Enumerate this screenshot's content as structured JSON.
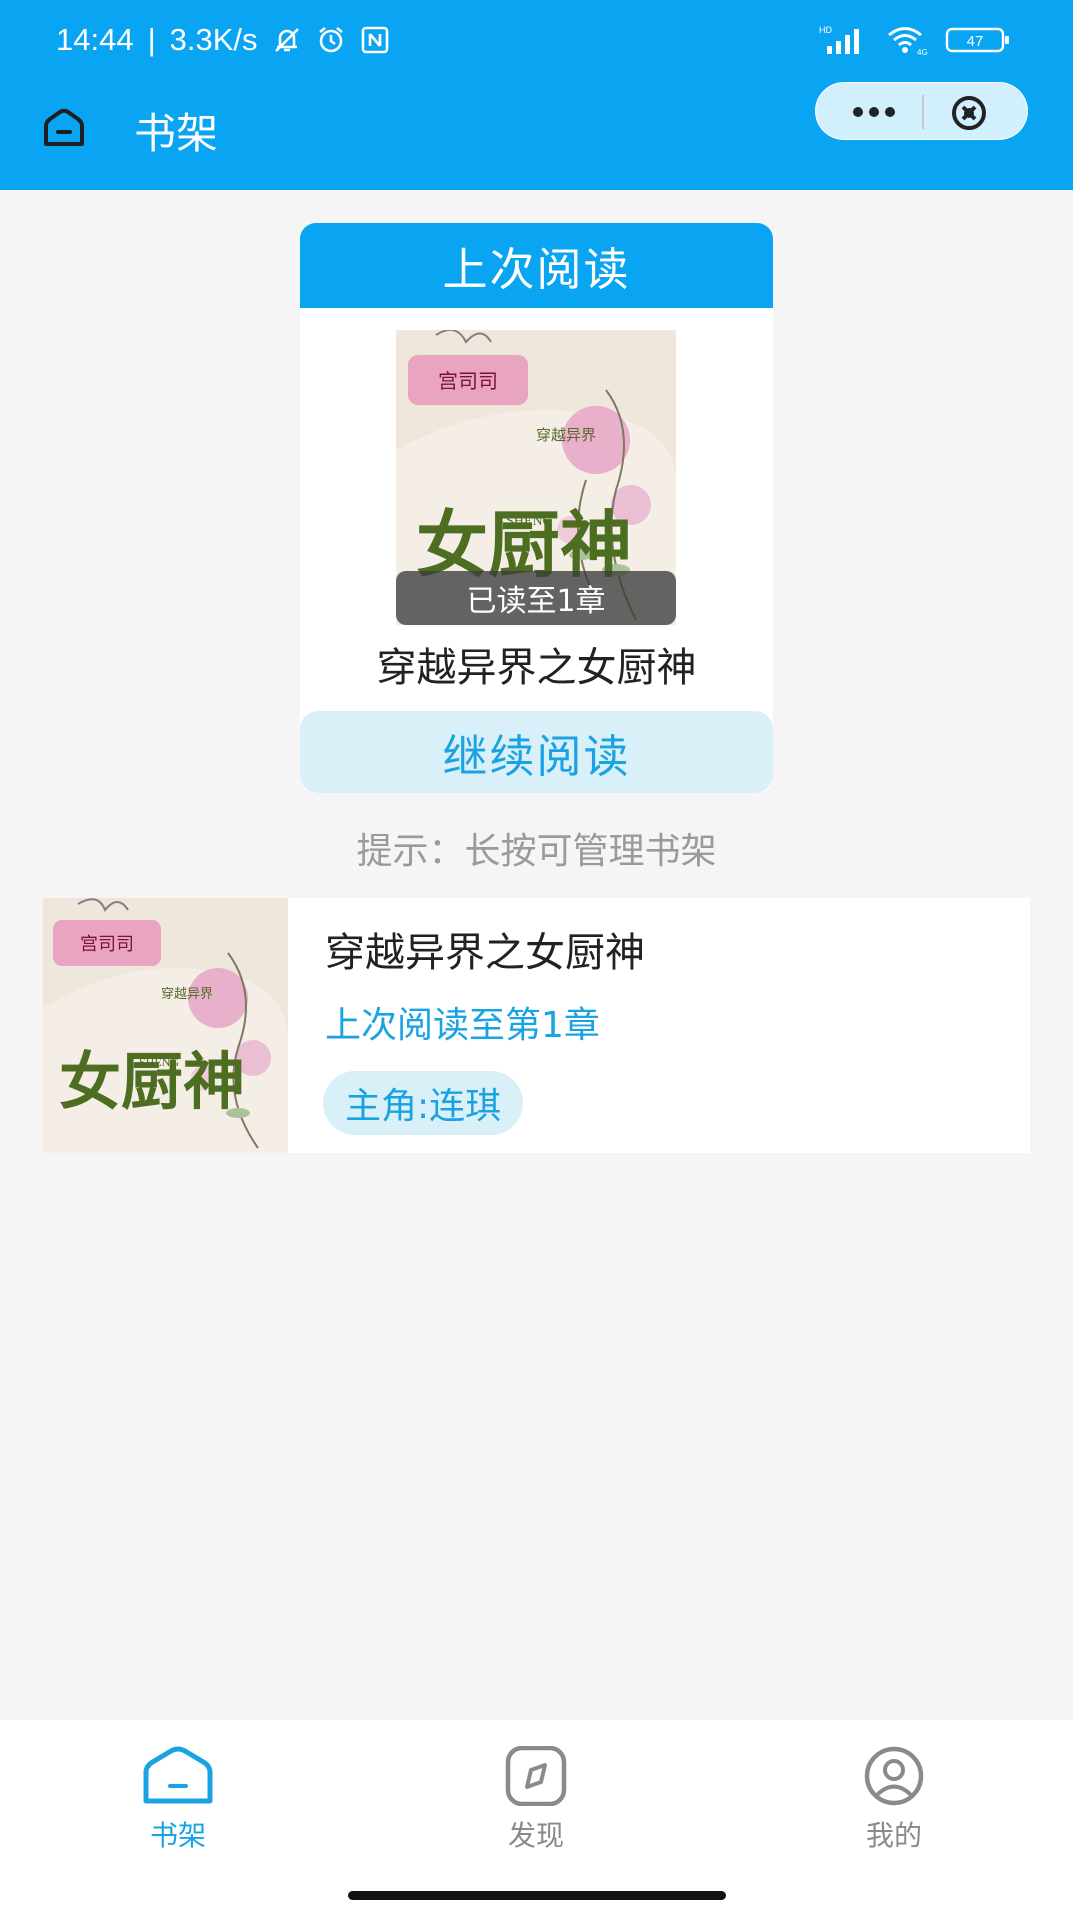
{
  "status_bar": {
    "time": "14:44",
    "net_speed": "3.3K/s",
    "battery": "47",
    "hd_label": "HD",
    "signal_tag": "4G"
  },
  "nav": {
    "title": "书架"
  },
  "last_read": {
    "header": "上次阅读",
    "progress": "已读至1章",
    "book_title": "穿越异界之女厨神",
    "continue_label": "继续阅读"
  },
  "tip": "提示：长按可管理书架",
  "shelf": [
    {
      "title": "穿越异界之女厨神",
      "last_read": "上次阅读至第1章",
      "tag": "主角:连琪"
    }
  ],
  "cover_art": {
    "badge": "宫司司",
    "side_text": "穿越异界",
    "main_text": "女厨神",
    "latin": "SHENG"
  },
  "tabs": [
    {
      "label": "书架",
      "active": true
    },
    {
      "label": "发现",
      "active": false
    },
    {
      "label": "我的",
      "active": false
    }
  ],
  "colors": {
    "primary": "#09a4f2",
    "accent_text": "#1aa3e3",
    "tag_bg": "#daf0f9",
    "page_bg": "#f5f5f5"
  },
  "icons": [
    "home-icon",
    "more-dots-icon",
    "close-circle-icon",
    "bookshelf-tab-icon",
    "compass-tab-icon",
    "profile-tab-icon",
    "mute-bell-icon",
    "alarm-icon",
    "nfc-icon",
    "signal-icon",
    "wifi-icon",
    "battery-icon"
  ]
}
